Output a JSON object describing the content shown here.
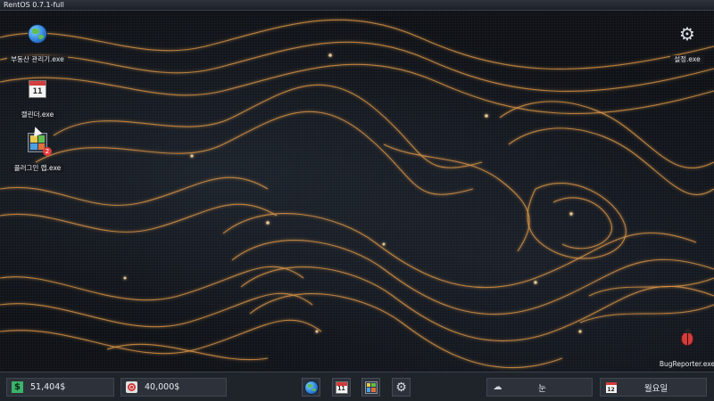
{
  "window": {
    "title": "RentOS 0.7.1-full"
  },
  "desktop": {
    "icons": [
      {
        "label": "부동산 관리기.exe",
        "icon": "globe-icon"
      },
      {
        "label": "캘린더.exe",
        "icon": "calendar-icon",
        "glyph_text": "11"
      },
      {
        "label": "플러그인 랩.exe",
        "icon": "plugin-icon",
        "badge": "2"
      },
      {
        "label": "설정.exe",
        "icon": "gear-icon"
      },
      {
        "label": "BugReporter.exe",
        "icon": "bug-icon"
      }
    ]
  },
  "taskbar": {
    "balance": {
      "value": "51,404$",
      "icon": "money-icon"
    },
    "goal": {
      "value": "40,000$",
      "icon": "target-icon"
    },
    "apps": [
      {
        "icon": "globe-icon"
      },
      {
        "icon": "calendar-icon",
        "glyph_text": "11"
      },
      {
        "icon": "plugin-icon"
      },
      {
        "icon": "gear-icon"
      }
    ],
    "weather": {
      "value": "눈",
      "icon": "snow-cloud-icon"
    },
    "day": {
      "value": "월요일",
      "icon": "calendar-icon",
      "glyph_text": "12"
    }
  },
  "colors": {
    "wallpaper_glow": "#f0a24a",
    "taskbar_bg": "#1f232a",
    "pill_bg": "#2d323a",
    "money_green": "#3bb36a",
    "alert_red": "#e03a3a"
  }
}
